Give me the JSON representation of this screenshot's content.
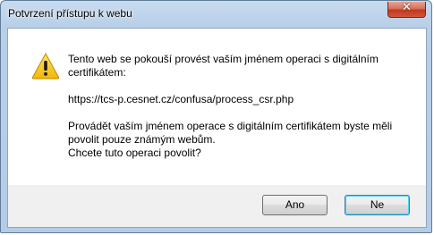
{
  "window": {
    "title": "Potvrzení přístupu k webu",
    "close_glyph": "✕"
  },
  "icon": "warning-icon",
  "message": {
    "line1": "Tento web se pokouší provést vaším jménem operaci s digitálním certifikátem:",
    "url": "https://tcs-p.cesnet.cz/confusa/process_csr.php",
    "line2": "Provádět vaším jménem operace s digitálním certifikátem byste měli povolit pouze známým webům.",
    "line3": "Chcete tuto operaci povolit?"
  },
  "buttons": {
    "yes_label": "Ano",
    "no_label": "Ne"
  },
  "colors": {
    "warning_yellow": "#f4c20d",
    "close_red": "#c0391e"
  }
}
